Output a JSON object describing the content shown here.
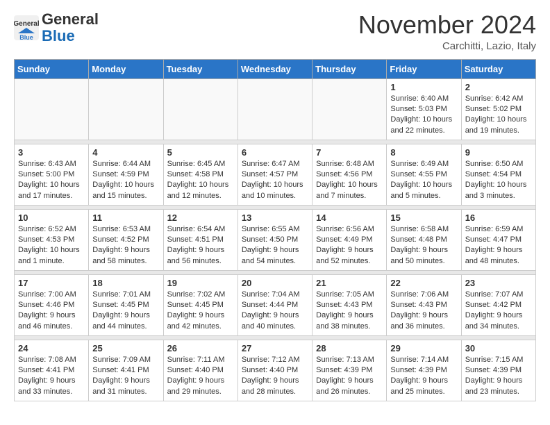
{
  "header": {
    "logo_line1": "General",
    "logo_line2": "Blue",
    "month_title": "November 2024",
    "location": "Carchitti, Lazio, Italy"
  },
  "days_of_week": [
    "Sunday",
    "Monday",
    "Tuesday",
    "Wednesday",
    "Thursday",
    "Friday",
    "Saturday"
  ],
  "weeks": [
    {
      "days": [
        {
          "num": "",
          "info": ""
        },
        {
          "num": "",
          "info": ""
        },
        {
          "num": "",
          "info": ""
        },
        {
          "num": "",
          "info": ""
        },
        {
          "num": "",
          "info": ""
        },
        {
          "num": "1",
          "info": "Sunrise: 6:40 AM\nSunset: 5:03 PM\nDaylight: 10 hours and 22 minutes."
        },
        {
          "num": "2",
          "info": "Sunrise: 6:42 AM\nSunset: 5:02 PM\nDaylight: 10 hours and 19 minutes."
        }
      ]
    },
    {
      "days": [
        {
          "num": "3",
          "info": "Sunrise: 6:43 AM\nSunset: 5:00 PM\nDaylight: 10 hours and 17 minutes."
        },
        {
          "num": "4",
          "info": "Sunrise: 6:44 AM\nSunset: 4:59 PM\nDaylight: 10 hours and 15 minutes."
        },
        {
          "num": "5",
          "info": "Sunrise: 6:45 AM\nSunset: 4:58 PM\nDaylight: 10 hours and 12 minutes."
        },
        {
          "num": "6",
          "info": "Sunrise: 6:47 AM\nSunset: 4:57 PM\nDaylight: 10 hours and 10 minutes."
        },
        {
          "num": "7",
          "info": "Sunrise: 6:48 AM\nSunset: 4:56 PM\nDaylight: 10 hours and 7 minutes."
        },
        {
          "num": "8",
          "info": "Sunrise: 6:49 AM\nSunset: 4:55 PM\nDaylight: 10 hours and 5 minutes."
        },
        {
          "num": "9",
          "info": "Sunrise: 6:50 AM\nSunset: 4:54 PM\nDaylight: 10 hours and 3 minutes."
        }
      ]
    },
    {
      "days": [
        {
          "num": "10",
          "info": "Sunrise: 6:52 AM\nSunset: 4:53 PM\nDaylight: 10 hours and 1 minute."
        },
        {
          "num": "11",
          "info": "Sunrise: 6:53 AM\nSunset: 4:52 PM\nDaylight: 9 hours and 58 minutes."
        },
        {
          "num": "12",
          "info": "Sunrise: 6:54 AM\nSunset: 4:51 PM\nDaylight: 9 hours and 56 minutes."
        },
        {
          "num": "13",
          "info": "Sunrise: 6:55 AM\nSunset: 4:50 PM\nDaylight: 9 hours and 54 minutes."
        },
        {
          "num": "14",
          "info": "Sunrise: 6:56 AM\nSunset: 4:49 PM\nDaylight: 9 hours and 52 minutes."
        },
        {
          "num": "15",
          "info": "Sunrise: 6:58 AM\nSunset: 4:48 PM\nDaylight: 9 hours and 50 minutes."
        },
        {
          "num": "16",
          "info": "Sunrise: 6:59 AM\nSunset: 4:47 PM\nDaylight: 9 hours and 48 minutes."
        }
      ]
    },
    {
      "days": [
        {
          "num": "17",
          "info": "Sunrise: 7:00 AM\nSunset: 4:46 PM\nDaylight: 9 hours and 46 minutes."
        },
        {
          "num": "18",
          "info": "Sunrise: 7:01 AM\nSunset: 4:45 PM\nDaylight: 9 hours and 44 minutes."
        },
        {
          "num": "19",
          "info": "Sunrise: 7:02 AM\nSunset: 4:45 PM\nDaylight: 9 hours and 42 minutes."
        },
        {
          "num": "20",
          "info": "Sunrise: 7:04 AM\nSunset: 4:44 PM\nDaylight: 9 hours and 40 minutes."
        },
        {
          "num": "21",
          "info": "Sunrise: 7:05 AM\nSunset: 4:43 PM\nDaylight: 9 hours and 38 minutes."
        },
        {
          "num": "22",
          "info": "Sunrise: 7:06 AM\nSunset: 4:43 PM\nDaylight: 9 hours and 36 minutes."
        },
        {
          "num": "23",
          "info": "Sunrise: 7:07 AM\nSunset: 4:42 PM\nDaylight: 9 hours and 34 minutes."
        }
      ]
    },
    {
      "days": [
        {
          "num": "24",
          "info": "Sunrise: 7:08 AM\nSunset: 4:41 PM\nDaylight: 9 hours and 33 minutes."
        },
        {
          "num": "25",
          "info": "Sunrise: 7:09 AM\nSunset: 4:41 PM\nDaylight: 9 hours and 31 minutes."
        },
        {
          "num": "26",
          "info": "Sunrise: 7:11 AM\nSunset: 4:40 PM\nDaylight: 9 hours and 29 minutes."
        },
        {
          "num": "27",
          "info": "Sunrise: 7:12 AM\nSunset: 4:40 PM\nDaylight: 9 hours and 28 minutes."
        },
        {
          "num": "28",
          "info": "Sunrise: 7:13 AM\nSunset: 4:39 PM\nDaylight: 9 hours and 26 minutes."
        },
        {
          "num": "29",
          "info": "Sunrise: 7:14 AM\nSunset: 4:39 PM\nDaylight: 9 hours and 25 minutes."
        },
        {
          "num": "30",
          "info": "Sunrise: 7:15 AM\nSunset: 4:39 PM\nDaylight: 9 hours and 23 minutes."
        }
      ]
    }
  ]
}
